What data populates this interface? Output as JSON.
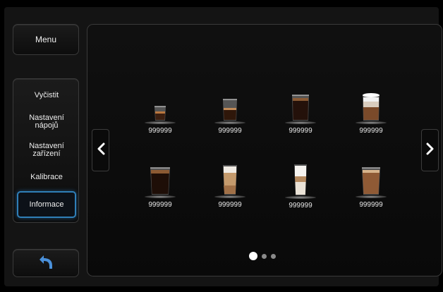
{
  "sidebar": {
    "menu_label": "Menu",
    "items": [
      {
        "label": "Vyčistit",
        "active": false
      },
      {
        "label": "Nastavení nápojů",
        "active": false
      },
      {
        "label": "Nastavení zařízení",
        "active": false
      },
      {
        "label": "Kalibrace",
        "active": false
      },
      {
        "label": "Informace",
        "active": true
      }
    ],
    "back_icon": "undo-arrow-icon"
  },
  "counters": [
    {
      "drink_icon": "espresso-glass-icon",
      "count": "999999"
    },
    {
      "drink_icon": "small-coffee-glass-icon",
      "count": "999999"
    },
    {
      "drink_icon": "coffee-glass-icon",
      "count": "999999"
    },
    {
      "drink_icon": "cappuccino-glass-icon",
      "count": "999999"
    },
    {
      "drink_icon": "americano-glass-icon",
      "count": "999999"
    },
    {
      "drink_icon": "latte-glass-icon",
      "count": "999999"
    },
    {
      "drink_icon": "latte-macchiato-glass-icon",
      "count": "999999"
    },
    {
      "drink_icon": "flat-white-glass-icon",
      "count": "999999"
    }
  ],
  "pagination": {
    "pages": 3,
    "current": 1
  },
  "colors": {
    "accent": "#2f7fb8",
    "back_arrow": "#4a90d9",
    "background": "#000000"
  }
}
